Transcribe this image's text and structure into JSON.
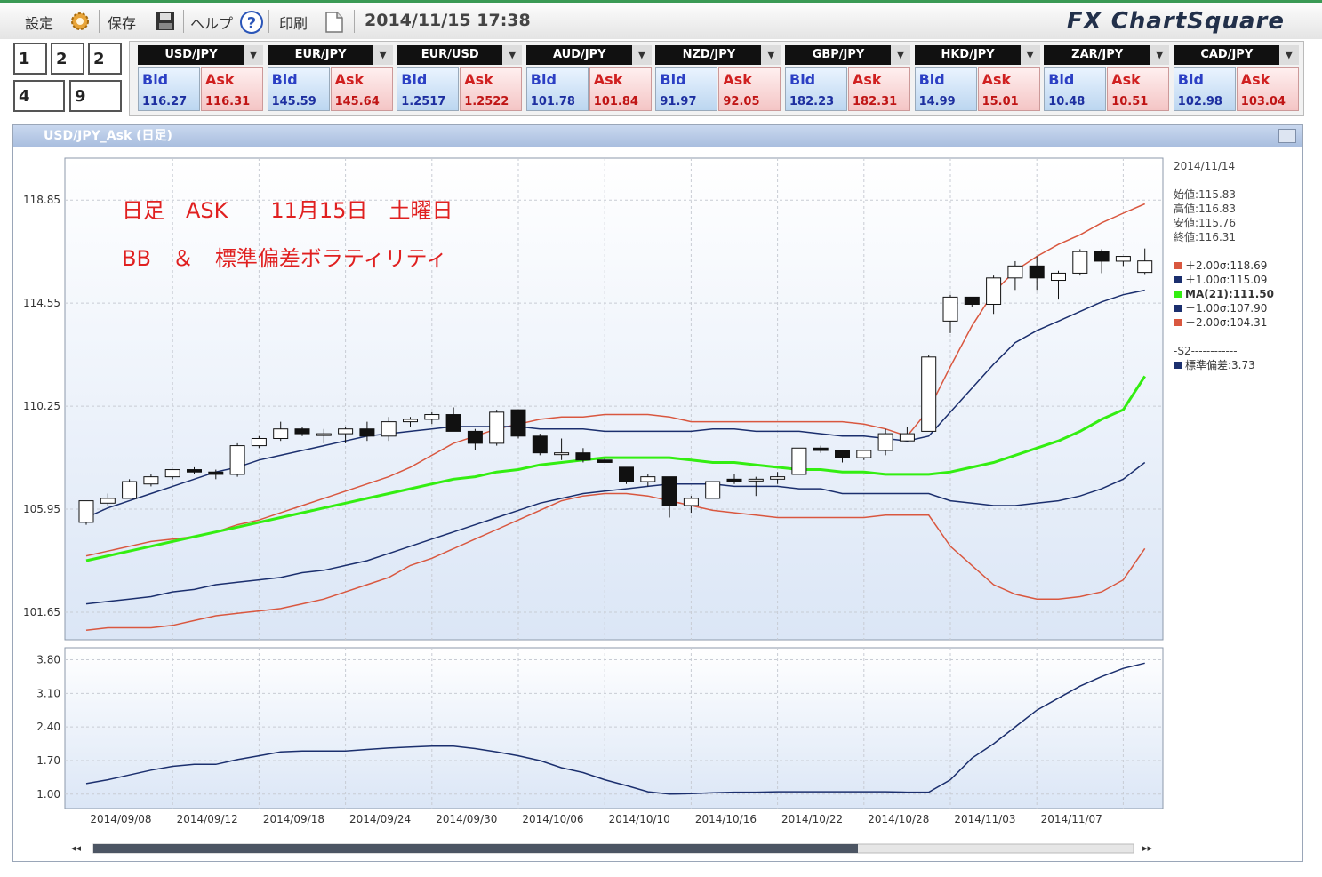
{
  "toolbar": {
    "settings_label": "設定",
    "save_label": "保存",
    "help_label": "ヘルプ",
    "print_label": "印刷",
    "datetime": "2014/11/15 17:38",
    "logo": "FX ChartSquare"
  },
  "layout_buttons": [
    "1",
    "2",
    "2",
    "4",
    "9"
  ],
  "pairs": [
    {
      "name": "USD/JPY",
      "bid": "116.27",
      "ask": "116.31"
    },
    {
      "name": "EUR/JPY",
      "bid": "145.59",
      "ask": "145.64"
    },
    {
      "name": "EUR/USD",
      "bid": "1.2517",
      "ask": "1.2522"
    },
    {
      "name": "AUD/JPY",
      "bid": "101.78",
      "ask": "101.84"
    },
    {
      "name": "NZD/JPY",
      "bid": "91.97",
      "ask": "92.05"
    },
    {
      "name": "GBP/JPY",
      "bid": "182.23",
      "ask": "182.31"
    },
    {
      "name": "HKD/JPY",
      "bid": "14.99",
      "ask": "15.01"
    },
    {
      "name": "ZAR/JPY",
      "bid": "10.48",
      "ask": "10.51"
    },
    {
      "name": "CAD/JPY",
      "bid": "102.98",
      "ask": "103.04"
    }
  ],
  "bid_label": "Bid",
  "ask_label": "Ask",
  "chart_window": {
    "title": "USD/JPY_Ask (日足)"
  },
  "annotations": {
    "line1": "日足　ASK　　11月15日　土曜日",
    "line2": "BB　＆　標準偏差ボラティリティ"
  },
  "info_panel": {
    "date": "2014/11/14",
    "ohlc": [
      "始値:115.83",
      "高値:116.83",
      "安値:115.76",
      "終値:116.31"
    ],
    "legend": [
      {
        "label": "＋2.00σ:118.69",
        "color": "#d9573f",
        "bold": false
      },
      {
        "label": "＋1.00σ:115.09",
        "color": "#1b2f6e",
        "bold": false
      },
      {
        "label": "MA(21):111.50",
        "color": "#33ee11",
        "bold": true
      },
      {
        "label": "－1.00σ:107.90",
        "color": "#1b2f6e",
        "bold": false
      },
      {
        "label": "－2.00σ:104.31",
        "color": "#d9573f",
        "bold": false
      }
    ],
    "sub_header": "-S2------------",
    "sub_legend": {
      "label": "標準偏差:3.73",
      "color": "#1b2f6e"
    }
  },
  "nav": {
    "left": "◂◂",
    "right": "▸▸"
  },
  "chart_data": [
    {
      "type": "candlestick",
      "title": "USD/JPY_Ask (日足)",
      "ylim": [
        100.5,
        120.6
      ],
      "yticks": [
        "118.85",
        "114.55",
        "110.25",
        "105.95",
        "101.65"
      ],
      "xtick_labels": [
        "2014/09/08",
        "2014/09/12",
        "2014/09/18",
        "2014/09/24",
        "2014/09/30",
        "2014/10/06",
        "2014/10/10",
        "2014/10/16",
        "2014/10/22",
        "2014/10/28",
        "2014/11/03",
        "2014/11/07"
      ],
      "candles": [
        {
          "o": 105.4,
          "h": 106.3,
          "l": 105.3,
          "c": 106.3
        },
        {
          "o": 106.2,
          "h": 106.6,
          "l": 106.1,
          "c": 106.4
        },
        {
          "o": 106.4,
          "h": 107.2,
          "l": 106.4,
          "c": 107.1
        },
        {
          "o": 107.0,
          "h": 107.4,
          "l": 106.9,
          "c": 107.3
        },
        {
          "o": 107.3,
          "h": 107.6,
          "l": 107.2,
          "c": 107.6
        },
        {
          "o": 107.6,
          "h": 107.7,
          "l": 107.4,
          "c": 107.5
        },
        {
          "o": 107.5,
          "h": 107.6,
          "l": 107.2,
          "c": 107.4
        },
        {
          "o": 107.4,
          "h": 108.7,
          "l": 107.3,
          "c": 108.6
        },
        {
          "o": 108.6,
          "h": 109.0,
          "l": 108.5,
          "c": 108.9
        },
        {
          "o": 108.9,
          "h": 109.6,
          "l": 108.8,
          "c": 109.3
        },
        {
          "o": 109.3,
          "h": 109.4,
          "l": 109.0,
          "c": 109.1
        },
        {
          "o": 109.1,
          "h": 109.3,
          "l": 108.7,
          "c": 109.1
        },
        {
          "o": 109.1,
          "h": 109.4,
          "l": 108.7,
          "c": 109.3
        },
        {
          "o": 109.3,
          "h": 109.6,
          "l": 108.8,
          "c": 109.0
        },
        {
          "o": 109.0,
          "h": 109.8,
          "l": 108.8,
          "c": 109.6
        },
        {
          "o": 109.6,
          "h": 109.8,
          "l": 109.4,
          "c": 109.7
        },
        {
          "o": 109.7,
          "h": 110.0,
          "l": 109.5,
          "c": 109.9
        },
        {
          "o": 109.9,
          "h": 110.2,
          "l": 109.2,
          "c": 109.2
        },
        {
          "o": 109.2,
          "h": 109.3,
          "l": 108.4,
          "c": 108.7
        },
        {
          "o": 108.7,
          "h": 110.1,
          "l": 108.6,
          "c": 110.0
        },
        {
          "o": 110.1,
          "h": 110.1,
          "l": 108.9,
          "c": 109.0
        },
        {
          "o": 109.0,
          "h": 109.1,
          "l": 108.2,
          "c": 108.3
        },
        {
          "o": 108.3,
          "h": 108.9,
          "l": 108.0,
          "c": 108.3
        },
        {
          "o": 108.3,
          "h": 108.5,
          "l": 107.9,
          "c": 108.0
        },
        {
          "o": 108.0,
          "h": 108.1,
          "l": 107.9,
          "c": 107.9
        },
        {
          "o": 107.7,
          "h": 107.7,
          "l": 107.0,
          "c": 107.1
        },
        {
          "o": 107.1,
          "h": 107.4,
          "l": 106.9,
          "c": 107.3
        },
        {
          "o": 107.3,
          "h": 107.3,
          "l": 105.6,
          "c": 106.1
        },
        {
          "o": 106.1,
          "h": 106.5,
          "l": 105.8,
          "c": 106.4
        },
        {
          "o": 106.4,
          "h": 107.1,
          "l": 106.4,
          "c": 107.1
        },
        {
          "o": 107.2,
          "h": 107.4,
          "l": 107.0,
          "c": 107.1
        },
        {
          "o": 107.2,
          "h": 107.3,
          "l": 106.5,
          "c": 107.2
        },
        {
          "o": 107.2,
          "h": 107.5,
          "l": 107.0,
          "c": 107.3
        },
        {
          "o": 107.4,
          "h": 108.5,
          "l": 107.4,
          "c": 108.5
        },
        {
          "o": 108.5,
          "h": 108.6,
          "l": 108.3,
          "c": 108.4
        },
        {
          "o": 108.4,
          "h": 108.4,
          "l": 107.9,
          "c": 108.1
        },
        {
          "o": 108.1,
          "h": 108.4,
          "l": 108.0,
          "c": 108.4
        },
        {
          "o": 108.4,
          "h": 109.3,
          "l": 108.2,
          "c": 109.1
        },
        {
          "o": 108.8,
          "h": 109.4,
          "l": 108.8,
          "c": 109.1
        },
        {
          "o": 109.2,
          "h": 112.4,
          "l": 109.2,
          "c": 112.3
        },
        {
          "o": 113.8,
          "h": 114.9,
          "l": 113.3,
          "c": 114.8
        },
        {
          "o": 114.8,
          "h": 114.8,
          "l": 114.4,
          "c": 114.5
        },
        {
          "o": 114.5,
          "h": 115.7,
          "l": 114.1,
          "c": 115.6
        },
        {
          "o": 115.6,
          "h": 116.3,
          "l": 115.1,
          "c": 116.1
        },
        {
          "o": 116.1,
          "h": 116.5,
          "l": 115.1,
          "c": 115.6
        },
        {
          "o": 115.5,
          "h": 115.9,
          "l": 114.7,
          "c": 115.8
        },
        {
          "o": 115.8,
          "h": 116.8,
          "l": 115.7,
          "c": 116.7
        },
        {
          "o": 116.7,
          "h": 116.8,
          "l": 115.8,
          "c": 116.3
        },
        {
          "o": 116.3,
          "h": 116.5,
          "l": 116.1,
          "c": 116.5
        },
        {
          "o": 115.83,
          "h": 116.83,
          "l": 115.76,
          "c": 116.31
        }
      ],
      "series": [
        {
          "name": "＋2.00σ",
          "color": "#d9573f",
          "values": [
            104.0,
            104.2,
            104.4,
            104.6,
            104.7,
            104.8,
            105.0,
            105.3,
            105.5,
            105.8,
            106.1,
            106.4,
            106.7,
            107.0,
            107.3,
            107.7,
            108.2,
            108.7,
            109.0,
            109.3,
            109.5,
            109.7,
            109.8,
            109.8,
            109.9,
            109.9,
            109.9,
            109.8,
            109.6,
            109.6,
            109.6,
            109.6,
            109.6,
            109.6,
            109.6,
            109.6,
            109.5,
            109.3,
            109.0,
            110.1,
            111.9,
            113.6,
            115.0,
            115.9,
            116.5,
            117.0,
            117.4,
            117.9,
            118.3,
            118.69
          ]
        },
        {
          "name": "＋1.00σ",
          "color": "#1b2f6e",
          "values": [
            105.6,
            106.0,
            106.3,
            106.6,
            106.9,
            107.2,
            107.5,
            107.7,
            108.0,
            108.2,
            108.4,
            108.6,
            108.8,
            109.0,
            109.1,
            109.2,
            109.3,
            109.4,
            109.4,
            109.4,
            109.4,
            109.3,
            109.3,
            109.3,
            109.2,
            109.2,
            109.2,
            109.2,
            109.2,
            109.3,
            109.3,
            109.2,
            109.2,
            109.2,
            109.1,
            109.0,
            109.0,
            108.9,
            108.8,
            109.0,
            110.0,
            111.0,
            112.0,
            112.9,
            113.4,
            113.8,
            114.2,
            114.6,
            114.9,
            115.09
          ]
        },
        {
          "name": "MA(21)",
          "color": "#33ee11",
          "values": [
            103.8,
            104.0,
            104.2,
            104.4,
            104.6,
            104.8,
            105.0,
            105.2,
            105.4,
            105.6,
            105.8,
            106.0,
            106.2,
            106.4,
            106.6,
            106.8,
            107.0,
            107.2,
            107.3,
            107.5,
            107.6,
            107.8,
            107.9,
            108.0,
            108.1,
            108.1,
            108.1,
            108.1,
            108.0,
            107.9,
            107.9,
            107.8,
            107.7,
            107.6,
            107.6,
            107.5,
            107.5,
            107.4,
            107.4,
            107.4,
            107.5,
            107.7,
            107.9,
            108.2,
            108.5,
            108.8,
            109.2,
            109.7,
            110.1,
            111.5
          ]
        },
        {
          "name": "－1.00σ",
          "color": "#1b2f6e",
          "values": [
            102.0,
            102.1,
            102.2,
            102.3,
            102.5,
            102.6,
            102.8,
            102.9,
            103.0,
            103.1,
            103.3,
            103.4,
            103.6,
            103.8,
            104.1,
            104.4,
            104.7,
            105.0,
            105.3,
            105.6,
            105.9,
            106.2,
            106.4,
            106.6,
            106.7,
            106.8,
            106.9,
            107.0,
            107.0,
            107.0,
            106.9,
            106.9,
            106.9,
            106.8,
            106.8,
            106.6,
            106.6,
            106.6,
            106.6,
            106.6,
            106.3,
            106.2,
            106.1,
            106.1,
            106.2,
            106.3,
            106.5,
            106.8,
            107.2,
            107.9
          ]
        },
        {
          "name": "－2.00σ",
          "color": "#d9573f",
          "values": [
            100.9,
            101.0,
            101.0,
            101.0,
            101.1,
            101.3,
            101.5,
            101.6,
            101.7,
            101.8,
            102.0,
            102.2,
            102.5,
            102.8,
            103.1,
            103.6,
            103.9,
            104.3,
            104.7,
            105.1,
            105.5,
            105.9,
            106.3,
            106.5,
            106.6,
            106.6,
            106.5,
            106.3,
            106.1,
            105.9,
            105.8,
            105.7,
            105.6,
            105.6,
            105.6,
            105.6,
            105.6,
            105.7,
            105.7,
            105.7,
            104.4,
            103.6,
            102.8,
            102.4,
            102.2,
            102.2,
            102.3,
            102.5,
            103.0,
            104.31
          ]
        }
      ]
    },
    {
      "type": "line",
      "title": "",
      "ylim": [
        0.7,
        4.05
      ],
      "yticks": [
        "3.80",
        "3.10",
        "2.40",
        "1.70",
        "1.00"
      ],
      "series": [
        {
          "name": "標準偏差",
          "color": "#1b2f6e",
          "values": [
            1.22,
            1.3,
            1.4,
            1.5,
            1.58,
            1.62,
            1.62,
            1.72,
            1.8,
            1.88,
            1.9,
            1.9,
            1.9,
            1.93,
            1.96,
            1.98,
            2.0,
            2.0,
            1.95,
            1.88,
            1.8,
            1.7,
            1.55,
            1.45,
            1.3,
            1.18,
            1.05,
            1.0,
            1.01,
            1.03,
            1.04,
            1.04,
            1.05,
            1.05,
            1.05,
            1.05,
            1.05,
            1.05,
            1.04,
            1.04,
            1.3,
            1.75,
            2.05,
            2.4,
            2.75,
            3.0,
            3.25,
            3.45,
            3.62,
            3.73
          ]
        }
      ]
    }
  ]
}
